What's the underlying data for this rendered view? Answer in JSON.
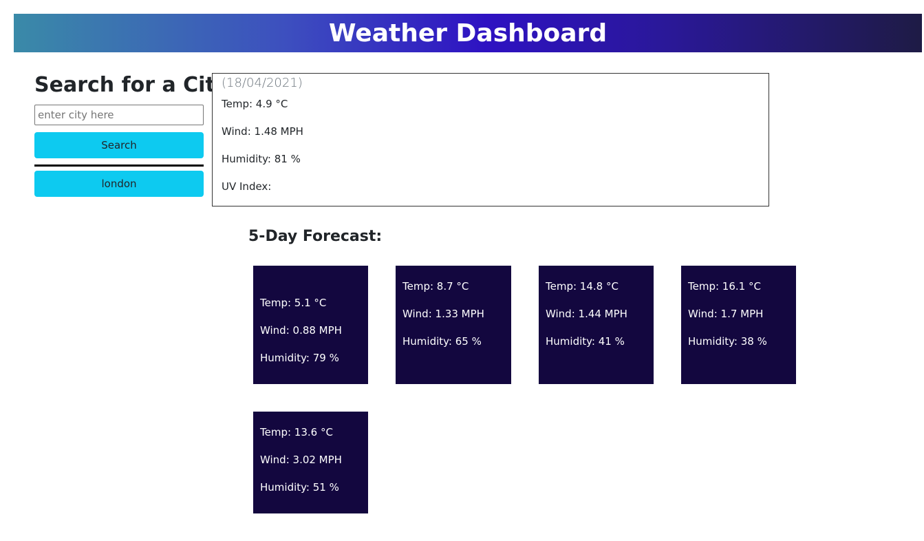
{
  "header": {
    "title": "Weather Dashboard"
  },
  "search": {
    "title": "Search for a City:",
    "placeholder": "enter city here",
    "value": "",
    "button_label": "Search",
    "history": [
      "london"
    ]
  },
  "current": {
    "date": "(18/04/2021)",
    "temp": "Temp: 4.9 °C",
    "wind": "Wind: 1.48 MPH",
    "humidity": "Humidity: 81 %",
    "uv": "UV Index:"
  },
  "forecast": {
    "title": "5-Day Forecast:",
    "days": [
      {
        "temp": "Temp: 5.1 °C",
        "wind": "Wind: 0.88 MPH",
        "humidity": "Humidity: 79 %"
      },
      {
        "temp": "Temp: 8.7 °C",
        "wind": "Wind: 1.33 MPH",
        "humidity": "Humidity: 65 %"
      },
      {
        "temp": "Temp: 14.8 °C",
        "wind": "Wind: 1.44 MPH",
        "humidity": "Humidity: 41 %"
      },
      {
        "temp": "Temp: 16.1 °C",
        "wind": "Wind: 1.7 MPH",
        "humidity": "Humidity: 38 %"
      },
      {
        "temp": "Temp: 13.6 °C",
        "wind": "Wind: 3.02 MPH",
        "humidity": "Humidity: 51 %"
      }
    ]
  },
  "colors": {
    "accent_button": "#0dcaf0",
    "card_background": "#13073f",
    "header_gradient_start": "#3a8aa8",
    "header_gradient_end": "#1e1b45"
  }
}
